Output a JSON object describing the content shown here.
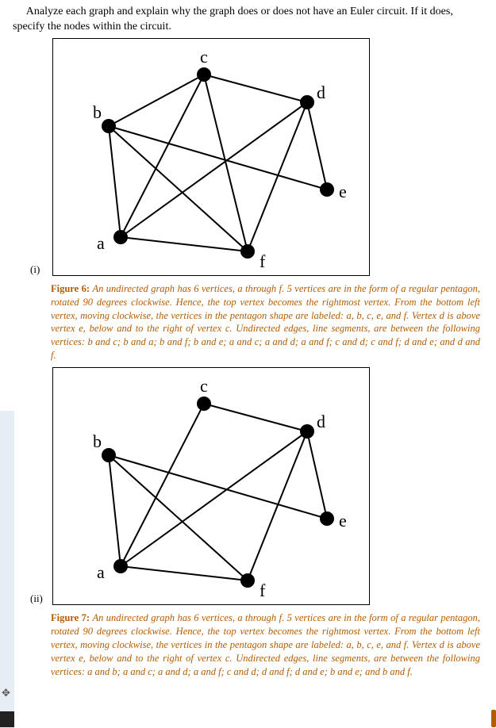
{
  "instruction": "Analyze each graph and explain why the graph does or does not have an Euler circuit. If it does, specify the nodes within the circuit.",
  "item_i": "(i)",
  "item_ii": "(ii)",
  "figure6": {
    "label": "Figure 6:",
    "desc": "An undirected graph has 6 vertices, a through f. 5 vertices are in the form of a regular pentagon, rotated 90 degrees clockwise. Hence, the top vertex becomes the rightmost vertex. From the bottom left vertex, moving clockwise, the vertices in the pentagon shape are labeled: a, b, c, e, and f. Vertex d is above vertex e, below and to the right of vertex c. Undirected edges, line segments, are between the following vertices: b and c; b and a; b and f; b and e; a and c; a and d; a and f; c and d; c and f; d and e; and d and f.",
    "graph": {
      "vertices": {
        "a": "a",
        "b": "b",
        "c": "c",
        "d": "d",
        "e": "e",
        "f": "f"
      },
      "edges": [
        "b-c",
        "b-a",
        "b-f",
        "b-e",
        "a-c",
        "a-d",
        "a-f",
        "c-d",
        "c-f",
        "d-e",
        "d-f"
      ]
    }
  },
  "figure7": {
    "label": "Figure 7:",
    "desc": "An undirected graph has 6 vertices, a through f. 5 vertices are in the form of a regular pentagon, rotated 90 degrees clockwise. Hence, the top vertex becomes the rightmost vertex. From the bottom left vertex, moving clockwise, the vertices in the pentagon shape are labeled: a, b, c, e, and f. Vertex d is above vertex e, below and to the right of vertex c. Undirected edges, line segments, are between the following vertices: a and b; a and c; a and d; a and f; c and d; d and f; d and e; b and e; and b and f.",
    "graph": {
      "vertices": {
        "a": "a",
        "b": "b",
        "c": "c",
        "d": "d",
        "e": "e",
        "f": "f"
      },
      "edges": [
        "a-b",
        "a-c",
        "a-d",
        "a-f",
        "c-d",
        "d-f",
        "d-e",
        "b-e",
        "b-f"
      ]
    }
  },
  "chart_data": [
    {
      "type": "graph",
      "title": "Figure 6",
      "nodes": [
        "a",
        "b",
        "c",
        "d",
        "e",
        "f"
      ],
      "edges": [
        [
          "b",
          "c"
        ],
        [
          "b",
          "a"
        ],
        [
          "b",
          "f"
        ],
        [
          "b",
          "e"
        ],
        [
          "a",
          "c"
        ],
        [
          "a",
          "d"
        ],
        [
          "a",
          "f"
        ],
        [
          "c",
          "d"
        ],
        [
          "c",
          "f"
        ],
        [
          "d",
          "e"
        ],
        [
          "d",
          "f"
        ]
      ]
    },
    {
      "type": "graph",
      "title": "Figure 7",
      "nodes": [
        "a",
        "b",
        "c",
        "d",
        "e",
        "f"
      ],
      "edges": [
        [
          "a",
          "b"
        ],
        [
          "a",
          "c"
        ],
        [
          "a",
          "d"
        ],
        [
          "a",
          "f"
        ],
        [
          "c",
          "d"
        ],
        [
          "d",
          "f"
        ],
        [
          "d",
          "e"
        ],
        [
          "b",
          "e"
        ],
        [
          "b",
          "f"
        ]
      ]
    }
  ]
}
